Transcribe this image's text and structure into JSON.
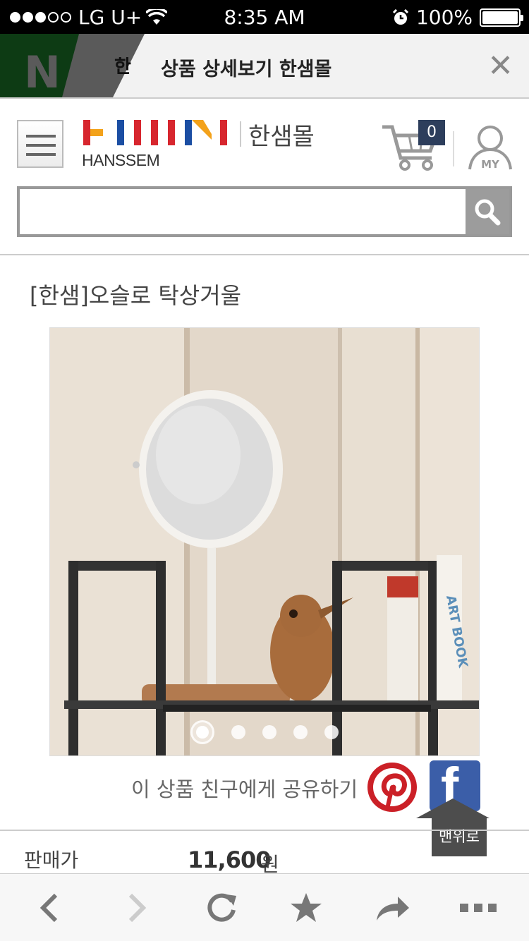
{
  "status_bar": {
    "carrier": "LG U+",
    "time": "8:35 AM",
    "battery": "100%"
  },
  "browser": {
    "tab_title": "상품 상세보기 한샘몰",
    "tab_favicon_letter": "N"
  },
  "header": {
    "logo_text": "HANSSEM",
    "mall_name": "한샘몰",
    "cart_count": "0",
    "my_label": "MY",
    "search_placeholder": ""
  },
  "product": {
    "title": "[한샘]오슬로 탁상거울",
    "image_count": 5,
    "active_image": 1,
    "share_text": "이 상품 친구에게 공유하기",
    "scroll_top_label": "맨위로",
    "price_label": "판매가",
    "price_value": "11,600",
    "price_unit": "원"
  },
  "colors": {
    "cart_badge": "#2d3e5c",
    "facebook": "#3b5ea8",
    "pinterest": "#cb2027",
    "logo_red": "#d7262e",
    "logo_blue": "#1b4ea3",
    "logo_yellow": "#f3a21b"
  },
  "toolbar": {
    "icons": [
      "back-icon",
      "forward-icon",
      "reload-icon",
      "bookmark-star-icon",
      "share-icon",
      "more-icon"
    ]
  }
}
